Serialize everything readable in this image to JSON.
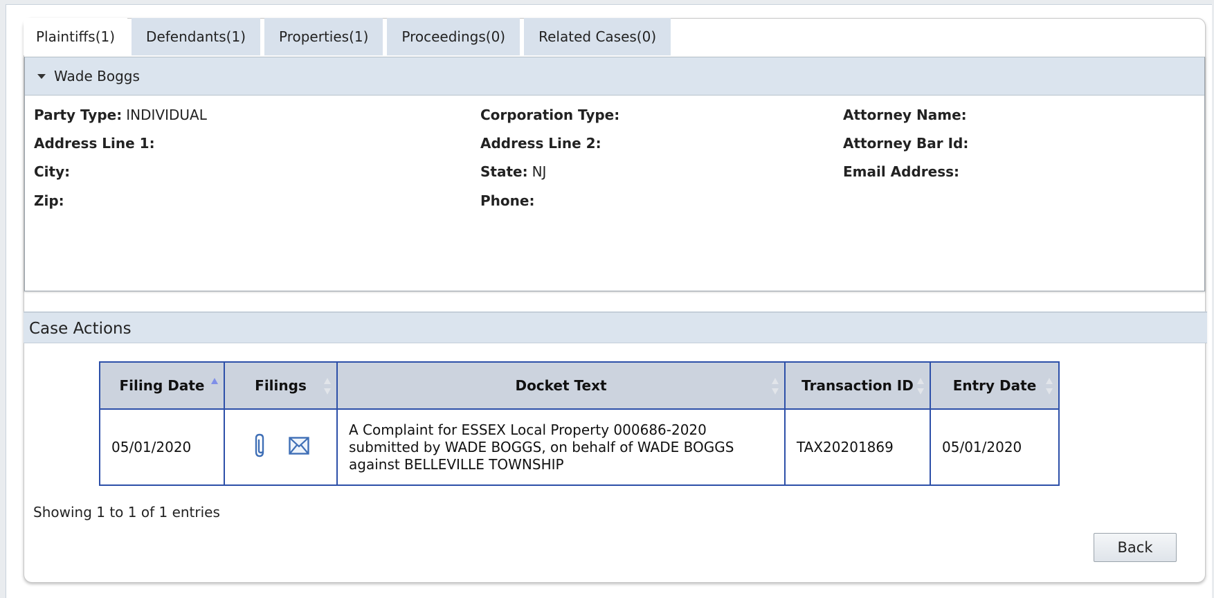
{
  "tabs": [
    {
      "label": "Plaintiffs(1)",
      "active": true
    },
    {
      "label": "Defendants(1)",
      "active": false
    },
    {
      "label": "Properties(1)",
      "active": false
    },
    {
      "label": "Proceedings(0)",
      "active": false
    },
    {
      "label": "Related Cases(0)",
      "active": false
    }
  ],
  "party": {
    "name": "Wade Boggs",
    "fields": {
      "party_type": {
        "label": "Party Type:",
        "value": "INDIVIDUAL"
      },
      "address_line_1": {
        "label": "Address Line 1:",
        "value": ""
      },
      "city": {
        "label": "City:",
        "value": ""
      },
      "zip": {
        "label": "Zip:",
        "value": ""
      },
      "corporation_type": {
        "label": "Corporation Type:",
        "value": ""
      },
      "address_line_2": {
        "label": "Address Line 2:",
        "value": ""
      },
      "state": {
        "label": "State:",
        "value": "NJ"
      },
      "phone": {
        "label": "Phone:",
        "value": ""
      },
      "attorney_name": {
        "label": "Attorney Name:",
        "value": ""
      },
      "attorney_bar_id": {
        "label": "Attorney Bar Id:",
        "value": ""
      },
      "email_address": {
        "label": "Email Address:",
        "value": ""
      }
    }
  },
  "case_actions": {
    "title": "Case Actions",
    "columns": {
      "filing_date": "Filing Date",
      "filings": "Filings",
      "docket_text": "Docket Text",
      "transaction_id": "Transaction ID",
      "entry_date": "Entry Date"
    },
    "sorted_column": "Filing Date",
    "rows": [
      {
        "filing_date": "05/01/2020",
        "filings_icons": [
          "paperclip-icon",
          "envelope-icon"
        ],
        "docket_text": "A Complaint for ESSEX Local Property 000686-2020 submitted by WADE BOGGS, on behalf of WADE BOGGS against BELLEVILLE TOWNSHIP",
        "transaction_id": "TAX20201869",
        "entry_date": "05/01/2020"
      }
    ],
    "summary": "Showing 1 to 1 of 1 entries"
  },
  "back_label": "Back",
  "colors": {
    "tab_bg": "#d8e1ec",
    "header_bg": "#dbe4ee",
    "table_border": "#2c4fa8",
    "table_header_bg": "#ccd3de",
    "sort_active": "#7f8fe8",
    "icon_blue": "#3f6fb6"
  }
}
